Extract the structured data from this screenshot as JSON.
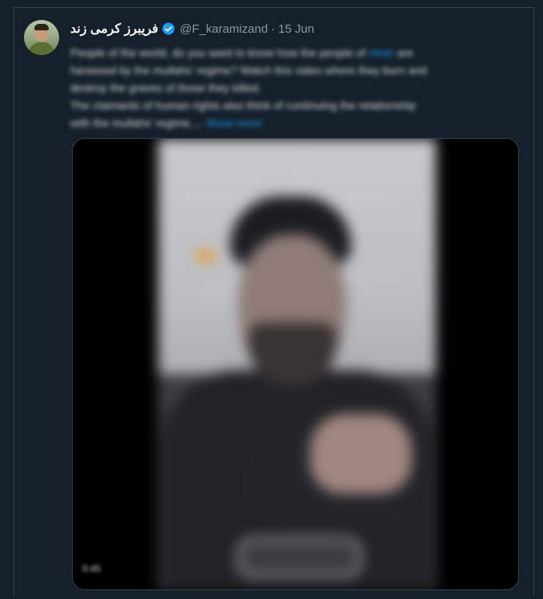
{
  "tweet": {
    "author": {
      "display_name": "فريبرز کرمی زند",
      "handle": "@F_karamizand",
      "verified": true
    },
    "separator": "·",
    "date": "15 Jun",
    "text_lines": [
      "People of the world, do you want to know how the people of #Iran are",
      "harassed by the mullahs' regime? Watch this video where they burn and",
      "destroy the graves of those they killed.",
      "The claimants of human rights also think of continuing the relationship",
      "with the mullahs' regime...."
    ],
    "hashtag": "#Iran",
    "show_more_label": "Show more"
  },
  "media": {
    "duration": "0:45"
  },
  "colors": {
    "background": "#15202b",
    "border": "#38444d",
    "link": "#1d9bf0",
    "secondary_text": "#8b98a5",
    "primary_text": "#f7f9f9"
  },
  "icons": [
    "verified-badge-icon"
  ]
}
